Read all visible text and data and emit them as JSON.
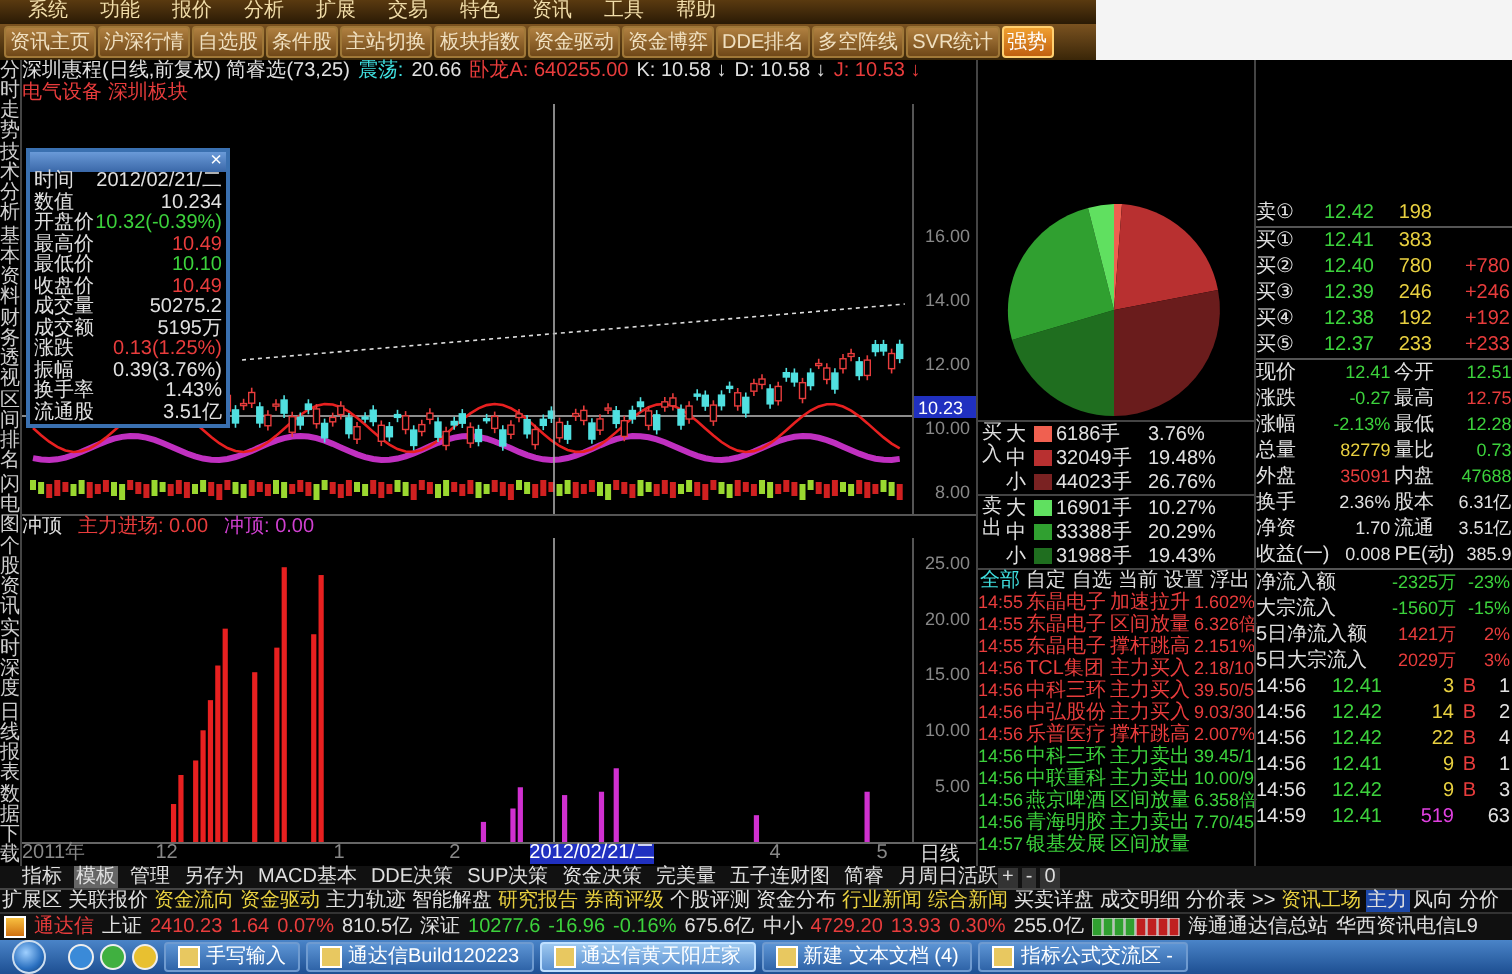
{
  "menu": [
    "系统",
    "功能",
    "报价",
    "分析",
    "扩展",
    "交易",
    "特色",
    "资讯",
    "工具",
    "帮助"
  ],
  "toolbar": [
    {
      "label": "资讯主页",
      "selected": false
    },
    {
      "label": "沪深行情",
      "selected": false
    },
    {
      "label": "自选股",
      "selected": false
    },
    {
      "label": "条件股",
      "selected": false
    },
    {
      "label": "主站切换",
      "selected": false
    },
    {
      "label": "板块指数",
      "selected": false
    },
    {
      "label": "资金驱动",
      "selected": false
    },
    {
      "label": "资金博弈",
      "selected": false
    },
    {
      "label": "DDE排名",
      "selected": false
    },
    {
      "label": "多空阵线",
      "selected": false
    },
    {
      "label": "SVR统计",
      "selected": false
    },
    {
      "label": "强势",
      "selected": true
    }
  ],
  "side_tabs": [
    "分时走势",
    "技术分析",
    "基本资料",
    "财务透视",
    "区间排名",
    "闪电图",
    "个股资讯",
    "实时深度",
    "日线报表",
    "数据下载"
  ],
  "chart_header": {
    "title": "深圳惠程(日线,前复权) 简睿选(73,25)",
    "items": [
      {
        "text": "震荡:",
        "color": "#40e0e0"
      },
      {
        "text": "20.66",
        "color": "#e0e0e0"
      },
      {
        "text": "卧龙A: 640255.00",
        "color": "#e83c3c"
      }
    ],
    "indicators": [
      {
        "label": "K: 10.58",
        "arrow": "↓",
        "color": "#e0e0e0"
      },
      {
        "label": "D: 10.58",
        "arrow": "↓",
        "color": "#e0e0e0"
      },
      {
        "label": "J: 10.53",
        "arrow": "↓",
        "color": "#e83c3c"
      }
    ]
  },
  "sector": "电气设备 深圳板块",
  "price_axis": [
    "16.00",
    "14.00",
    "12.00",
    "10.00",
    "8.00"
  ],
  "price_marker": "10.23",
  "data_window": {
    "close": "×",
    "rows": [
      {
        "label": "时间",
        "value": "2012/02/21/二",
        "color": "#e0e0e0"
      },
      {
        "label": "数值",
        "value": "10.234",
        "color": "#e0e0e0"
      },
      {
        "label": "开盘价",
        "value": "10.32(-0.39%)",
        "color": "#3cd23c"
      },
      {
        "label": "最高价",
        "value": "10.49",
        "color": "#e83c3c"
      },
      {
        "label": "最低价",
        "value": "10.10",
        "color": "#3cd23c"
      },
      {
        "label": "收盘价",
        "value": "10.49",
        "color": "#e83c3c"
      },
      {
        "label": "成交量",
        "value": "50275.2",
        "color": "#e0e0e0"
      },
      {
        "label": "成交额",
        "value": "5195万",
        "color": "#e0e0e0"
      },
      {
        "label": "涨跌",
        "value": "0.13(1.25%)",
        "color": "#e83c3c"
      },
      {
        "label": "振幅",
        "value": "0.39(3.76%)",
        "color": "#e0e0e0"
      },
      {
        "label": "换手率",
        "value": "1.43%",
        "color": "#e0e0e0"
      },
      {
        "label": "流通股",
        "value": "3.51亿",
        "color": "#e0e0e0"
      }
    ]
  },
  "lower_panel": {
    "title": "冲顶",
    "legend": [
      {
        "text": "主力进场: 0.00",
        "color": "#e83c3c"
      },
      {
        "text": "冲顶: 0.00",
        "color": "#d040d0"
      }
    ],
    "value_axis": [
      "25.00",
      "20.00",
      "15.00",
      "10.00",
      "5.00"
    ]
  },
  "time_axis": {
    "labels": [
      {
        "text": "2011年",
        "selected": false
      },
      {
        "text": "12",
        "selected": false
      },
      {
        "text": "1",
        "selected": false
      },
      {
        "text": "2",
        "selected": false
      },
      {
        "text": "2012/02/21/二",
        "selected": true
      },
      {
        "text": "4",
        "selected": false
      },
      {
        "text": "5",
        "selected": false
      }
    ],
    "period": "日线"
  },
  "zoom_controls": [
    "+",
    "-",
    "0"
  ],
  "money_flow": [
    {
      "side": "买入",
      "rows": [
        {
          "size": "大",
          "volume": "6186手",
          "pct": "3.76%",
          "color": "#f06050"
        },
        {
          "size": "中",
          "volume": "32049手",
          "pct": "19.48%",
          "color": "#b83030"
        },
        {
          "size": "小",
          "volume": "44023手",
          "pct": "26.76%",
          "color": "#7a2222"
        }
      ]
    },
    {
      "side": "卖出",
      "rows": [
        {
          "size": "大",
          "volume": "16901手",
          "pct": "10.27%",
          "color": "#60e060"
        },
        {
          "size": "中",
          "volume": "33388手",
          "pct": "20.29%",
          "color": "#30a030"
        },
        {
          "size": "小",
          "volume": "31988手",
          "pct": "19.43%",
          "color": "#1f6e1f"
        }
      ]
    }
  ],
  "tick_filters": [
    {
      "label": "全部",
      "selected": true
    },
    {
      "label": "自定",
      "selected": false
    },
    {
      "label": "自选",
      "selected": false
    },
    {
      "label": "当前",
      "selected": false
    },
    {
      "label": "设置",
      "selected": false
    },
    {
      "label": "浮出",
      "selected": false
    }
  ],
  "ticks": [
    {
      "time": "14:55",
      "name": "东晶电子",
      "signal": "加速拉升",
      "value": "1.602%",
      "color": "#e83c3c"
    },
    {
      "time": "14:55",
      "name": "东晶电子",
      "signal": "区间放量",
      "value": "6.326倍",
      "color": "#e83c3c"
    },
    {
      "time": "14:55",
      "name": "东晶电子",
      "signal": "撑杆跳高",
      "value": "2.151%",
      "color": "#e83c3c"
    },
    {
      "time": "14:56",
      "name": "TCL集团",
      "signal": "主力买入",
      "value": "2.18/10",
      "color": "#e83c3c"
    },
    {
      "time": "14:56",
      "name": "中科三环",
      "signal": "主力买入",
      "value": "39.50/5",
      "color": "#e83c3c"
    },
    {
      "time": "14:56",
      "name": "中弘股份",
      "signal": "主力买入",
      "value": "9.03/30",
      "color": "#e83c3c"
    },
    {
      "time": "14:56",
      "name": "乐普医疗",
      "signal": "撑杆跳高",
      "value": "2.007%",
      "color": "#e83c3c"
    },
    {
      "time": "14:56",
      "name": "中科三环",
      "signal": "主力卖出",
      "value": "39.45/1",
      "color": "#3cd23c"
    },
    {
      "time": "14:56",
      "name": "中联重科",
      "signal": "主力卖出",
      "value": "10.00/9",
      "color": "#3cd23c"
    },
    {
      "time": "14:56",
      "name": "燕京啤酒",
      "signal": "区间放量",
      "value": "6.358倍",
      "color": "#3cd23c"
    },
    {
      "time": "14:56",
      "name": "青海明胶",
      "signal": "主力卖出",
      "value": "7.70/45",
      "color": "#3cd23c"
    },
    {
      "time": "14:57",
      "name": "银基发展",
      "signal": "区间放量",
      "color": "#3cd23c"
    }
  ],
  "quote": [
    {
      "label": "卖①",
      "price": "12.42",
      "volume": "198",
      "kind": "ask"
    },
    {
      "label": "买①",
      "price": "12.41",
      "volume": "383",
      "kind": "bid"
    },
    {
      "label": "买②",
      "price": "12.40",
      "volume": "780",
      "change": "+780",
      "kind": "bid"
    },
    {
      "label": "买③",
      "price": "12.39",
      "volume": "246",
      "change": "+246",
      "kind": "bid"
    },
    {
      "label": "买④",
      "price": "12.38",
      "volume": "192",
      "change": "+192",
      "kind": "bid"
    },
    {
      "label": "买⑤",
      "price": "12.37",
      "volume": "233",
      "change": "+233",
      "kind": "bid"
    }
  ],
  "stats": [
    {
      "label": "现价",
      "value": "12.41",
      "color": "#3cd23c"
    },
    {
      "label": "今开",
      "value": "12.51",
      "color": "#3cd23c"
    },
    {
      "label": "涨跌",
      "value": "-0.27",
      "color": "#3cd23c"
    },
    {
      "label": "最高",
      "value": "12.75",
      "color": "#e83c3c"
    },
    {
      "label": "涨幅",
      "value": "-2.13%",
      "color": "#3cd23c"
    },
    {
      "label": "最低",
      "value": "12.28",
      "color": "#3cd23c"
    },
    {
      "label": "总量",
      "value": "82779",
      "color": "#e8d040"
    },
    {
      "label": "量比",
      "value": "0.73",
      "color": "#3cd23c"
    },
    {
      "label": "外盘",
      "value": "35091",
      "color": "#e83c3c"
    },
    {
      "label": "内盘",
      "value": "47688",
      "color": "#3cd23c"
    },
    {
      "label": "换手",
      "value": "2.36%",
      "color": "#e0e0e0"
    },
    {
      "label": "股本",
      "value": "6.31亿",
      "color": "#e0e0e0"
    },
    {
      "label": "净资",
      "value": "1.70",
      "color": "#e0e0e0"
    },
    {
      "label": "流通",
      "value": "3.51亿",
      "color": "#e0e0e0"
    },
    {
      "label": "收益(一)",
      "value": "0.008",
      "color": "#e0e0e0"
    },
    {
      "label": "PE(动)",
      "value": "385.9",
      "color": "#e0e0e0"
    }
  ],
  "flow_summary": [
    {
      "label": "净流入额",
      "amount": "-2325万",
      "pct": "-23%",
      "color": "#3cd23c"
    },
    {
      "label": "大宗流入",
      "amount": "-1560万",
      "pct": "-15%",
      "color": "#3cd23c"
    },
    {
      "label": "5日净流入额",
      "amount": "1421万",
      "pct": "2%",
      "color": "#e83c3c"
    },
    {
      "label": "5日大宗流入",
      "amount": "2029万",
      "pct": "3%",
      "color": "#e83c3c"
    }
  ],
  "trades": [
    {
      "time": "14:56",
      "price": "12.41",
      "volume": "3",
      "side": "B",
      "count": "1",
      "color": "#e8d040"
    },
    {
      "time": "14:56",
      "price": "12.42",
      "volume": "14",
      "side": "B",
      "count": "2",
      "color": "#e8d040"
    },
    {
      "time": "14:56",
      "price": "12.42",
      "volume": "22",
      "side": "B",
      "count": "4",
      "color": "#e8d040"
    },
    {
      "time": "14:56",
      "price": "12.41",
      "volume": "9",
      "side": "B",
      "count": "1",
      "color": "#e8d040"
    },
    {
      "time": "14:56",
      "price": "12.42",
      "volume": "9",
      "side": "B",
      "count": "3",
      "color": "#e8d040"
    },
    {
      "time": "14:59",
      "price": "12.41",
      "volume": "519",
      "count": "63",
      "color": "#e040e0"
    }
  ],
  "formula_tabs": [
    {
      "label": "指标",
      "selected": false
    },
    {
      "label": "模板",
      "selected": true
    },
    {
      "label": "管理",
      "selected": false
    },
    {
      "label": "另存为",
      "selected": false
    },
    {
      "label": "MACD基本",
      "selected": false
    },
    {
      "label": "DDE决策",
      "selected": false
    },
    {
      "label": "SUP决策",
      "selected": false
    },
    {
      "label": "资金决策",
      "selected": false
    },
    {
      "label": "完美量",
      "selected": false
    },
    {
      "label": "五子连财图",
      "selected": false
    },
    {
      "label": "简睿",
      "selected": false
    },
    {
      "label": "月周日活跃",
      "selected": false
    }
  ],
  "extension_tabs": [
    {
      "label": "扩展区",
      "kind": "plain",
      "selected": false
    },
    {
      "label": "关联报价",
      "kind": "plain",
      "selected": false
    },
    {
      "label": "资金流向",
      "kind": "feature",
      "selected": false
    },
    {
      "label": "资金驱动",
      "kind": "feature",
      "selected": false
    },
    {
      "label": "主力轨迹",
      "kind": "plain",
      "selected": false
    },
    {
      "label": "智能解盘",
      "kind": "plain",
      "selected": false
    },
    {
      "label": "研究报告",
      "kind": "feature",
      "selected": false
    },
    {
      "label": "券商评级",
      "kind": "feature",
      "selected": false
    },
    {
      "label": "个股评测",
      "kind": "plain",
      "selected": false
    },
    {
      "label": "资金分布",
      "kind": "plain",
      "selected": false
    },
    {
      "label": "行业新闻",
      "kind": "feature",
      "selected": false
    },
    {
      "label": "综合新闻",
      "kind": "feature",
      "selected": false
    },
    {
      "label": "买卖详盘",
      "kind": "plain",
      "selected": false
    },
    {
      "label": "成交明细",
      "kind": "plain",
      "selected": false
    },
    {
      "label": "分价表",
      "kind": "plain",
      "selected": false
    },
    {
      "label": ">>",
      "kind": "plain",
      "selected": false
    },
    {
      "label": "资讯工场",
      "kind": "feature",
      "selected": false
    },
    {
      "label": "主力",
      "kind": "plain",
      "selected": true
    },
    {
      "label": "风向",
      "kind": "plain",
      "selected": false
    },
    {
      "label": "分价",
      "kind": "plain",
      "selected": false
    }
  ],
  "status_bar": {
    "app": "通达信",
    "indices": [
      {
        "name": "上证",
        "value": "2410.23",
        "change": "1.64",
        "pct": "0.07%",
        "amount": "810.5亿",
        "kind": "up"
      },
      {
        "name": "深证",
        "value": "10277.6",
        "change": "-16.96",
        "pct": "-0.16%",
        "amount": "675.6亿",
        "kind": "down"
      },
      {
        "name": "中小",
        "value": "4729.20",
        "change": "13.93",
        "pct": "0.30%",
        "amount": "255.0亿",
        "kind": "up"
      }
    ],
    "sites": [
      "海通通达信总站",
      "华西资讯电信L9"
    ]
  },
  "taskbar": [
    {
      "label": "手写输入",
      "active": false
    },
    {
      "label": "通达信Build120223",
      "active": false
    },
    {
      "label": "通达信黄天阳庄家",
      "active": true
    },
    {
      "label": "新建 文本文档 (4)",
      "active": false
    },
    {
      "label": "指标公式交流区 -",
      "active": false
    }
  ]
}
